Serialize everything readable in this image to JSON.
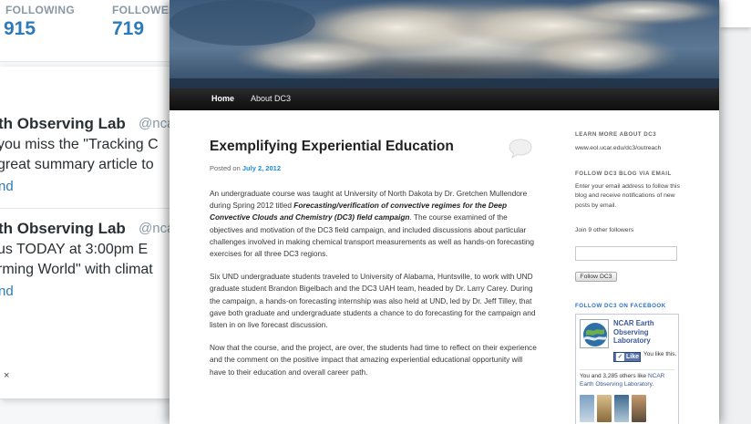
{
  "twitter": {
    "following_label": "FOLLOWING",
    "following_value": "915",
    "followers_label": "FOLLOWER",
    "followers_value": "719",
    "tweets": [
      {
        "author": "th Observing Lab",
        "handle": "@ncar",
        "line1": "you miss the \"Tracking C",
        "line2": "great summary article to",
        "expand": "nd"
      },
      {
        "author": "th Observing Lab",
        "handle": "@ncar",
        "line1": "us TODAY at 3:00pm E",
        "line2": "rming World\" with climat",
        "expand": "nd"
      }
    ],
    "close_glyph": "×"
  },
  "blog": {
    "nav": {
      "home": "Home",
      "about": "About DC3"
    },
    "post": {
      "title": "Exemplifying Experiential Education",
      "posted_on": "Posted on",
      "date": "July 2, 2012",
      "p1_before": "An undergraduate course was taught at University of North Dakota by Dr. Gretchen Mullendore during Spring 2012 titled ",
      "p1_emph": "Forecasting/verification of convective regimes for the Deep Convective Clouds and Chemistry (DC3) field campaign",
      "p1_after": ".  The course examined of the objectives and motivation of the DC3 field campaign, and included discussions about particular challenges involved in making chemical transport measurements as well as hands-on forecasting exercises for all three DC3 regions.",
      "p2": "Six UND undergraduate students traveled to University of Alabama, Huntsville, to work with UND graduate student Brandon Bigelbach and the DC3 UAH team, headed by Dr. Larry Carey. During the campaign, a hands-on forecasting internship was also held at UND, led by Dr. Jeff Tilley, that gave both graduate and undergraduate students a chance to do forecasting for the campaign and listen in on live forecast discussion.",
      "p3": "Now that the course, and the project, are over, the students had time to reflect on their experience and the comment on the positive impact that amazing experiential educational opportunity will have to their education and overall career path."
    },
    "sidebar": {
      "learn_title": "LEARN MORE ABOUT DC3",
      "learn_url": "www.eol.ucar.edu/dc3/outreach",
      "follow_title": "FOLLOW DC3 BLOG VIA EMAIL",
      "follow_desc": "Enter your email address to follow this blog and receive notifications of new posts by email.",
      "join_text": "Join 9 other followers",
      "email_value": "",
      "follow_button": "Follow DC3",
      "fb_title": "FOLLOW DC3 ON FACEBOOK",
      "fb_page_name": "NCAR Earth Observing Laboratory",
      "fb_logo_text": "EARTH OBSERVING LABORATORY",
      "fb_like_label": "Like",
      "fb_you_like": "You like this.",
      "fb_others_prefix": "You and 3,285 others like ",
      "fb_others_link": "NCAR Earth Observing Laboratory."
    }
  },
  "colors": {
    "twitter_blue": "#2b7bb9",
    "link_blue": "#1b8be0",
    "facebook_blue": "#3b5998",
    "nav_bg": "#1a1a1a"
  }
}
